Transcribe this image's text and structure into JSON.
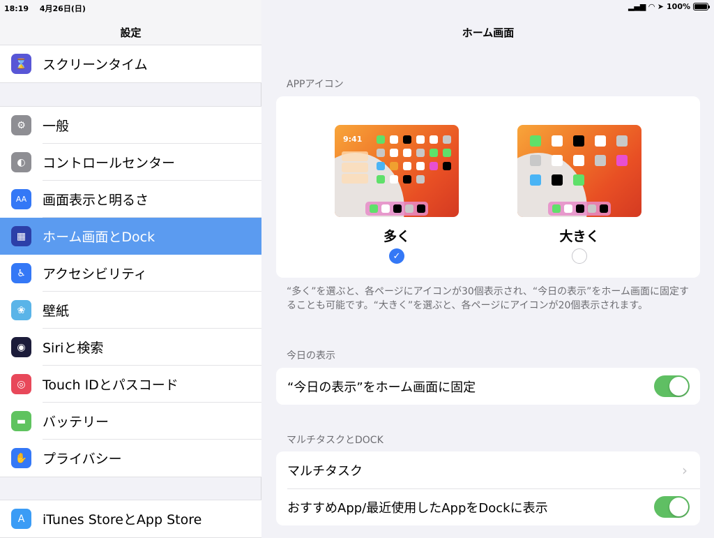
{
  "status_bar": {
    "time": "18:19",
    "date": "4月26日(日)",
    "battery_text": "100%",
    "battery_level": 1.0,
    "icons": [
      "signal-icon",
      "wifi-icon",
      "location-icon",
      "battery-icon"
    ]
  },
  "sidebar": {
    "title": "設定",
    "groups": [
      [
        {
          "label": "スクリーンタイム",
          "icon": "hourglass-icon",
          "color": "#5856d6",
          "glyph": "⌛"
        }
      ],
      [
        {
          "label": "一般",
          "icon": "gear-icon",
          "color": "#8e8e93",
          "glyph": "⚙"
        },
        {
          "label": "コントロールセンター",
          "icon": "toggles-icon",
          "color": "#8e8e93",
          "glyph": "◐"
        },
        {
          "label": "画面表示と明るさ",
          "icon": "text-size-icon",
          "color": "#3478f6",
          "glyph": "AA"
        },
        {
          "label": "ホーム画面とDock",
          "icon": "home-grid-icon",
          "color": "#2c3fa8",
          "glyph": "▦",
          "selected": true
        },
        {
          "label": "アクセシビリティ",
          "icon": "accessibility-icon",
          "color": "#3478f6",
          "glyph": "♿"
        },
        {
          "label": "壁紙",
          "icon": "flower-icon",
          "color": "#5ab4e8",
          "glyph": "❀"
        },
        {
          "label": "Siriと検索",
          "icon": "siri-icon",
          "color": "#1c1c3a",
          "glyph": "◉"
        },
        {
          "label": "Touch IDとパスコード",
          "icon": "fingerprint-icon",
          "color": "#e8485a",
          "glyph": "◎"
        },
        {
          "label": "バッテリー",
          "icon": "battery-icon",
          "color": "#5fc35f",
          "glyph": "▬"
        },
        {
          "label": "プライバシー",
          "icon": "hand-icon",
          "color": "#3478f6",
          "glyph": "✋"
        }
      ],
      [
        {
          "label": "iTunes StoreとApp Store",
          "icon": "app-store-icon",
          "color": "#3b9cf5",
          "glyph": "A"
        }
      ]
    ]
  },
  "detail": {
    "title": "ホーム画面",
    "app_icon_section": {
      "header": "APPアイコン",
      "options": [
        {
          "label": "多く",
          "selected": true,
          "preview_time": "9:41"
        },
        {
          "label": "大きく",
          "selected": false
        }
      ],
      "footer": "“多く”を選ぶと、各ページにアイコンが30個表示され、“今日の表示”をホーム画面に固定することも可能です。“大きく”を選ぶと、各ページにアイコンが20個表示されます。"
    },
    "today_section": {
      "header": "今日の表示",
      "rows": [
        {
          "label": "“今日の表示”をホーム画面に固定",
          "toggle": true
        }
      ]
    },
    "multitask_section": {
      "header": "マルチタスクとDOCK",
      "rows": [
        {
          "label": "マルチタスク",
          "chevron": true
        },
        {
          "label": "おすすめApp/最近使用したAppをDockに表示",
          "toggle": true
        }
      ]
    },
    "toggle_on_color": "#5fbf63",
    "accent_color": "#3478f6"
  }
}
